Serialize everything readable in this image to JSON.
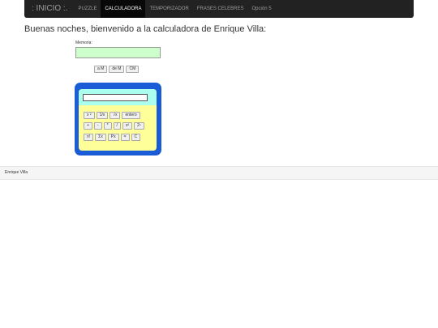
{
  "navbar": {
    "brand": ": INICIO :.",
    "items": [
      {
        "label": "PUZZLE"
      },
      {
        "label": "CALCULADORA"
      },
      {
        "label": "TEMPORIZADOR"
      },
      {
        "label": "FRASES CELEBRES"
      },
      {
        "label": "Opción 5"
      }
    ],
    "active_index": 1
  },
  "greeting": "Buenas noches, bienvenido a la calculadora de Enrique Villa:",
  "memory": {
    "label": "Memoria:",
    "value": "",
    "buttons": [
      "a M",
      "de M",
      "CM"
    ]
  },
  "calculator": {
    "display": "",
    "rows": [
      [
        "x ²",
        "1/x",
        "√x",
        "entero"
      ],
      [
        "+",
        "-",
        "*",
        "/",
        "x²",
        "2ⁿ"
      ],
      [
        "n!",
        "Σx",
        "Px",
        "=",
        "C"
      ]
    ]
  },
  "footer": {
    "text": "Enrique Villa"
  },
  "colors": {
    "navbar_bg": "#222222",
    "memory_field_bg": "#ccffcc",
    "calc_body": "#1a5bd6",
    "calc_panel": "#ffff99",
    "calc_top": "#aaffee"
  }
}
